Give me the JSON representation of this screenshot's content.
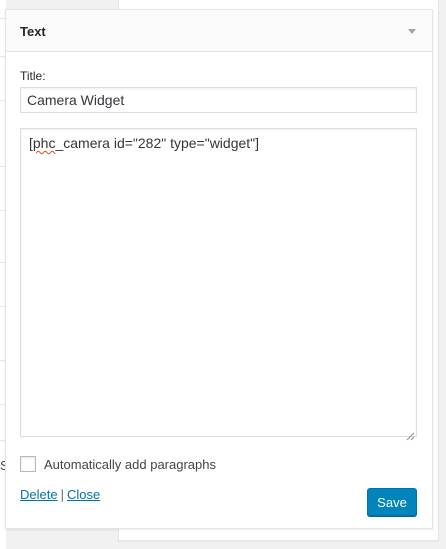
{
  "widget": {
    "header_title": "Text",
    "toggle_icon": "triangle-down-icon",
    "title_label": "Title:",
    "title_value": "Camera Widget",
    "content_misspelled": "phc",
    "content_before": "[",
    "content_after": "_camera id=\"282\" type=\"widget\"]",
    "autop_label": "Automatically add paragraphs",
    "autop_checked": false,
    "delete_label": "Delete",
    "separator": "|",
    "close_label": "Close",
    "save_label": "Save"
  },
  "background": {
    "left_fragment": "S"
  },
  "colors": {
    "primary_button": "#0085ba",
    "link": "#0073aa",
    "spellcheck": "#d54e21",
    "border": "#dddddd"
  }
}
